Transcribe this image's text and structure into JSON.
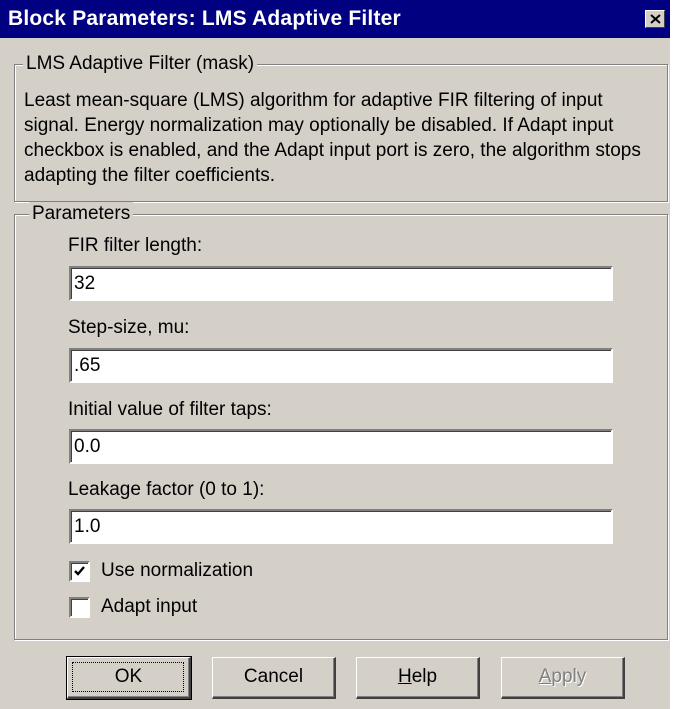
{
  "window": {
    "title": "Block Parameters: LMS Adaptive Filter"
  },
  "mask_group": {
    "legend": "LMS Adaptive Filter (mask)",
    "description": "Least mean-square (LMS) algorithm for adaptive FIR filtering of input signal.  Energy normalization may optionally be disabled. If Adapt input checkbox is enabled, and the Adapt input port is zero, the algorithm stops adapting the filter coefficients."
  },
  "parameters": {
    "legend": "Parameters",
    "fir_length": {
      "label": "FIR filter length:",
      "value": "32"
    },
    "step_size": {
      "label": "Step-size, mu:",
      "value": ".65"
    },
    "initial_taps": {
      "label": "Initial value of filter taps:",
      "value": "0.0"
    },
    "leakage": {
      "label": "Leakage factor (0 to 1):",
      "value": "1.0"
    },
    "use_normalization": {
      "label": "Use normalization",
      "checked": true
    },
    "adapt_input": {
      "label": "Adapt input",
      "checked": false
    }
  },
  "buttons": {
    "ok": {
      "label": "OK"
    },
    "cancel": {
      "label": "Cancel"
    },
    "help": {
      "first": "H",
      "rest": "elp"
    },
    "apply": {
      "first": "A",
      "rest": "pply",
      "disabled": true
    }
  },
  "icons": {
    "close": "close-icon",
    "check": "checkmark-icon"
  }
}
